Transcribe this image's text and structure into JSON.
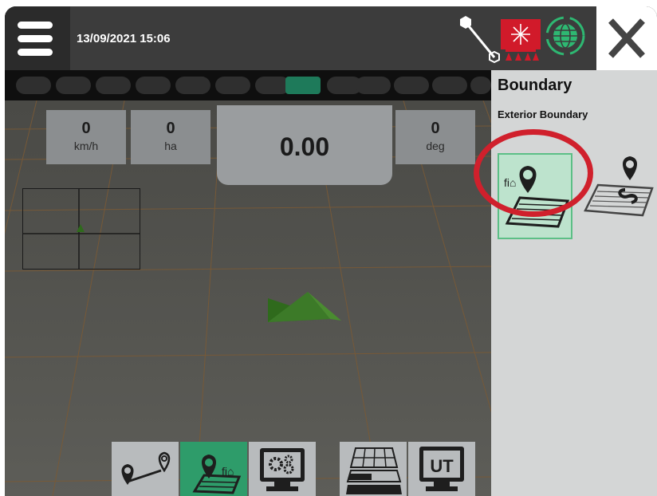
{
  "header": {
    "datetime": "13/09/2021 15:06"
  },
  "readouts": {
    "speed": {
      "value": "0",
      "unit": "km/h"
    },
    "area": {
      "value": "0",
      "unit": "ha"
    },
    "main": {
      "value": "0.00"
    },
    "heading": {
      "value": "0",
      "unit": "deg"
    }
  },
  "sections": {
    "count": 13,
    "active_index": 7
  },
  "panel": {
    "title": "Boundary",
    "subtitle": "Exterior Boundary"
  },
  "toolbar": {
    "buttons": [
      {
        "name": "guidance-lines-icon",
        "active": false
      },
      {
        "name": "boundary-icon",
        "active": true
      },
      {
        "name": "settings-screen-icon",
        "active": false
      },
      {
        "name": "coverage-map-icon",
        "active": false
      },
      {
        "name": "ut-icon",
        "label": "UT",
        "active": false
      }
    ]
  },
  "colors": {
    "accent_green": "#2e9c6a",
    "active_section": "#1e7a5a",
    "highlight_red": "#d0202c",
    "implement_red": "#d11a2a",
    "vehicle_green": "#3c7a28"
  }
}
